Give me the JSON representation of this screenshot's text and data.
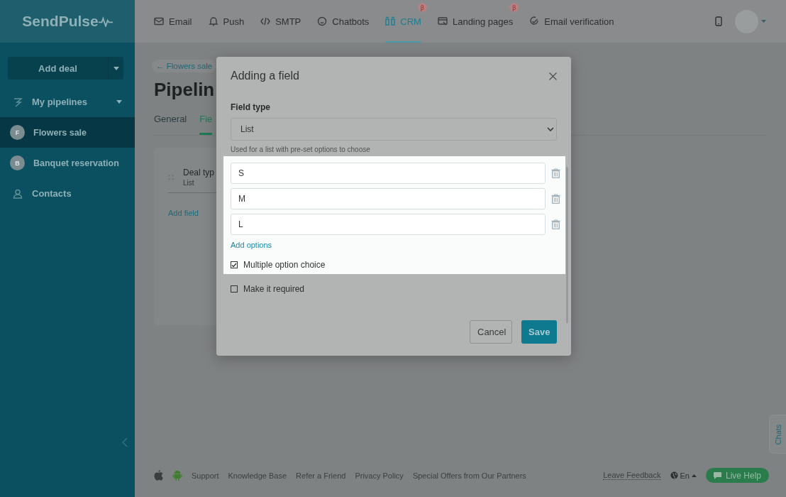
{
  "logo": "SendPulse",
  "nav": [
    {
      "label": "Email",
      "selected": false
    },
    {
      "label": "Push",
      "selected": false
    },
    {
      "label": "SMTP",
      "selected": false
    },
    {
      "label": "Chatbots",
      "selected": false
    },
    {
      "label": "CRM",
      "selected": true,
      "badge": "β"
    },
    {
      "label": "Landing pages",
      "selected": false,
      "badge": "β"
    },
    {
      "label": "Email verification",
      "selected": false
    }
  ],
  "sidebar": {
    "add_button": "Add deal",
    "pipelines_label": "My pipelines",
    "items": [
      {
        "avatar": "F",
        "label": "Flowers sale",
        "selected": true
      },
      {
        "avatar": "B",
        "label": "Banquet reservation",
        "selected": false
      }
    ],
    "contacts": "Contacts"
  },
  "main": {
    "breadcrumb": "← Flowers sale",
    "title": "Pipelin",
    "tabs": [
      {
        "label": "General",
        "selected": false
      },
      {
        "label": "Fie",
        "selected": true
      }
    ],
    "field": {
      "name": "Deal typ",
      "type": "List"
    },
    "add_field": "Add field"
  },
  "modal": {
    "title": "Adding a field",
    "field_type_label": "Field type",
    "field_type_value": "List",
    "hint": "Used for a list with pre-set options to choose",
    "options": [
      "S",
      "M",
      "L"
    ],
    "add_options": "Add options",
    "checkboxes": [
      {
        "label": "Multiple option choice",
        "checked": true
      },
      {
        "label": "Make it required",
        "checked": false
      }
    ],
    "buttons": [
      {
        "label": "Cancel",
        "kind": "secondary"
      },
      {
        "label": "Save",
        "kind": "primary"
      }
    ]
  },
  "footer": {
    "links": [
      "Support",
      "Knowledge Base",
      "Refer a Friend",
      "Privacy Policy",
      "Special Offers from Our Partners"
    ],
    "feedback": "Leave Feedback",
    "language": "En",
    "live_help": "Live Help"
  },
  "chats_tab": "Chats"
}
